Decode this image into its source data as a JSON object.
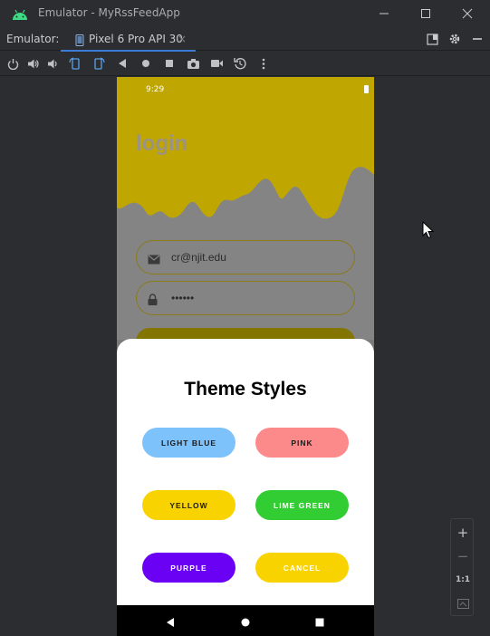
{
  "window": {
    "title": "Emulator - MyRssFeedApp",
    "icon": "android-icon",
    "controls": [
      "minimize-icon",
      "maximize-icon",
      "close-icon"
    ]
  },
  "tool_window": {
    "label": "Emulator:",
    "tab": {
      "label": "Pixel 6 Pro API 30",
      "icon": "phone-icon",
      "close": "×"
    },
    "right_icons": [
      "layout-icon",
      "gear-icon",
      "minimize-panel-icon"
    ]
  },
  "toolbar": {
    "icons": [
      "power-icon",
      "volume-up-icon",
      "volume-down-icon",
      "rotate-left-icon",
      "rotate-right-icon",
      "back-icon",
      "home-icon",
      "overview-icon",
      "camera-icon",
      "video-icon",
      "restore-icon",
      "more-icon"
    ]
  },
  "phone": {
    "status": {
      "time": "9:29"
    },
    "app": {
      "title": "login",
      "email": {
        "value": "cr@njit.edu",
        "icon": "mail-icon"
      },
      "password": {
        "value": "••••••",
        "icon": "lock-icon"
      }
    },
    "sheet": {
      "title": "Theme Styles",
      "buttons": [
        {
          "label": "LIGHT BLUE",
          "bg": "#7ec2fb",
          "fg": "#1a1a1a"
        },
        {
          "label": "PINK",
          "bg": "#fc8a8a",
          "fg": "#1a1a1a"
        },
        {
          "label": "YELLOW",
          "bg": "#f9d300",
          "fg": "#1a1a1a"
        },
        {
          "label": "LIME GREEN",
          "bg": "#32cd32",
          "fg": "#ffffff"
        },
        {
          "label": "PURPLE",
          "bg": "#6a00f4",
          "fg": "#ffffff"
        },
        {
          "label": "CANCEL",
          "bg": "#f9d300",
          "fg": "#ffffff"
        }
      ]
    },
    "nav": [
      "back-triangle-icon",
      "home-circle-icon",
      "recents-square-icon"
    ]
  },
  "zoom": {
    "zoom_in": "+",
    "zoom_out": "−",
    "actual": "1:1",
    "fit": "fit-screen-icon"
  },
  "colors": {
    "accent": "#3d7bd9",
    "app_header": "#bfa600",
    "ide_bg": "#2b2d30"
  }
}
